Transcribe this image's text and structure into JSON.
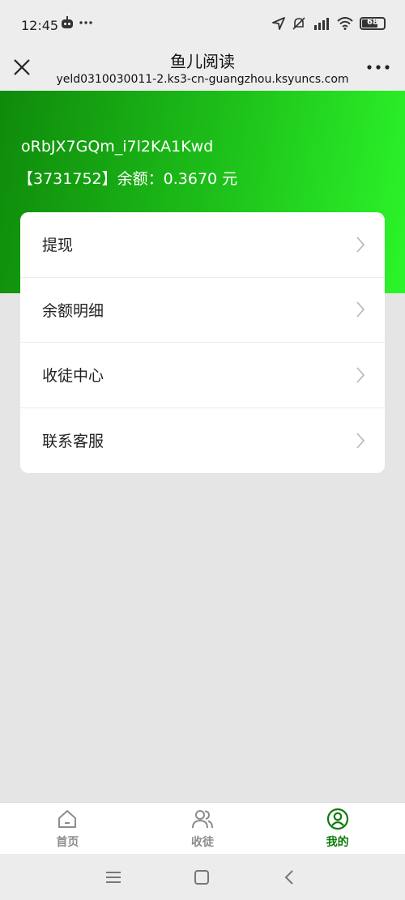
{
  "status_bar": {
    "time": "12:45",
    "battery": "68",
    "icons": [
      "robot-icon",
      "more-dots-icon",
      "location-icon",
      "mute-icon",
      "signal-icon",
      "wifi-icon",
      "battery-icon"
    ]
  },
  "nav": {
    "title": "鱼儿阅读",
    "subtitle": "yeld0310030011-2.ks3-cn-guangzhou.ksyuncs.com"
  },
  "header": {
    "user_id": "oRbJX7GQm_i7l2KA1Kwd",
    "account_number": "【3731752】",
    "balance_label": "余额：",
    "balance_value": "0.3670 元"
  },
  "menu": {
    "items": [
      {
        "label": "提现"
      },
      {
        "label": "余额明细"
      },
      {
        "label": "收徒中心"
      },
      {
        "label": "联系客服"
      }
    ]
  },
  "tabs": [
    {
      "label": "首页",
      "active": false
    },
    {
      "label": "收徒",
      "active": false
    },
    {
      "label": "我的",
      "active": true
    }
  ],
  "colors": {
    "accent": "#0c7a0a",
    "hero_start": "#0f8a0b",
    "hero_end": "#2cf52a"
  }
}
